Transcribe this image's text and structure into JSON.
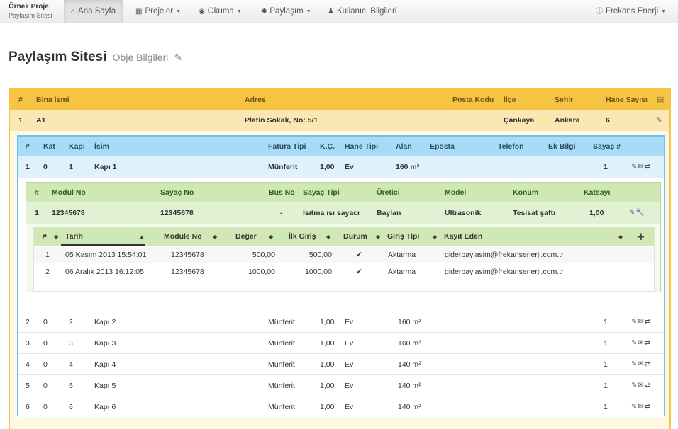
{
  "brand": {
    "name": "Örnek Proje",
    "subtitle": "Paylaşım Sitesi"
  },
  "nav": {
    "items": [
      {
        "label": "Ana Sayfa",
        "icon": "home-icon",
        "glyph": "⌂",
        "active": true
      },
      {
        "label": "Projeler",
        "icon": "briefcase-icon",
        "glyph": "▦",
        "caret": true
      },
      {
        "label": "Okuma",
        "icon": "eye-icon",
        "glyph": "◉",
        "caret": true
      },
      {
        "label": "Paylaşım",
        "icon": "asterisk-icon",
        "glyph": "✱",
        "caret": true
      },
      {
        "label": "Kullanıcı Bilgileri",
        "icon": "user-icon",
        "glyph": "♟"
      }
    ],
    "user": {
      "label": "Frekans Enerji",
      "icon": "info-icon",
      "glyph": "ⓘ"
    }
  },
  "page": {
    "title": "Paylaşım Sitesi",
    "subtitle": "Obje Bilgileri"
  },
  "buildings": {
    "headers": {
      "num": "#",
      "name": "Bina İsmi",
      "address": "Adres",
      "postal": "Posta Kodu",
      "district": "İlçe",
      "city": "Şehir",
      "households": "Hane Sayısı"
    },
    "row": {
      "num": "1",
      "name": "A1",
      "address": "Platin Sokak, No: 5/1",
      "postal": "",
      "district": "Çankaya",
      "city": "Ankara",
      "households": "6"
    }
  },
  "units": {
    "headers": {
      "num": "#",
      "floor": "Kat",
      "door": "Kapı",
      "name": "İsim",
      "invoice": "Fatura Tipi",
      "kc": "K.Ç.",
      "type": "Hane Tipi",
      "area": "Alan",
      "email": "Eposta",
      "phone": "Telefon",
      "extra": "Ek Bilgi",
      "meter": "Sayaç #"
    },
    "rows": [
      {
        "num": "1",
        "floor": "0",
        "door": "1",
        "name": "Kapı 1",
        "invoice": "Münferit",
        "kc": "1,00",
        "type": "Ev",
        "area": "160 m²",
        "meter": "1"
      },
      {
        "num": "2",
        "floor": "0",
        "door": "2",
        "name": "Kapı 2",
        "invoice": "Münferit",
        "kc": "1,00",
        "type": "Ev",
        "area": "160 m²",
        "meter": "1"
      },
      {
        "num": "3",
        "floor": "0",
        "door": "3",
        "name": "Kapı 3",
        "invoice": "Münferit",
        "kc": "1,00",
        "type": "Ev",
        "area": "160 m²",
        "meter": "1"
      },
      {
        "num": "4",
        "floor": "0",
        "door": "4",
        "name": "Kapı 4",
        "invoice": "Münferit",
        "kc": "1,00",
        "type": "Ev",
        "area": "140 m²",
        "meter": "1"
      },
      {
        "num": "5",
        "floor": "0",
        "door": "5",
        "name": "Kapı 5",
        "invoice": "Münferit",
        "kc": "1,00",
        "type": "Ev",
        "area": "140 m²",
        "meter": "1"
      },
      {
        "num": "6",
        "floor": "0",
        "door": "6",
        "name": "Kapı 6",
        "invoice": "Münferit",
        "kc": "1,00",
        "type": "Ev",
        "area": "140 m²",
        "meter": "1"
      }
    ]
  },
  "meters": {
    "headers": {
      "num": "#",
      "module": "Modül No",
      "meter": "Sayaç No",
      "bus": "Bus No",
      "type": "Sayaç Tipi",
      "maker": "Üretici",
      "model": "Model",
      "location": "Konum",
      "factor": "Katsayı"
    },
    "row": {
      "num": "1",
      "module": "12345678",
      "meter": "12345678",
      "bus": "-",
      "type": "Isıtma ısı sayacı",
      "maker": "Baylan",
      "model": "Ultrasonik",
      "location": "Tesisat şaftı",
      "factor": "1,00"
    }
  },
  "readings": {
    "headers": {
      "num": "#",
      "date": "Tarih",
      "module": "Module No",
      "value": "Değer",
      "first": "İlk Giriş",
      "status": "Durum",
      "entry": "Giriş Tipi",
      "by": "Kayıt Eden"
    },
    "rows": [
      {
        "num": "1",
        "date": "05 Kasım 2013 15:54:01",
        "module": "12345678",
        "value": "500,00",
        "first": "500,00",
        "status": "✔",
        "entry": "Aktarma",
        "by": "giderpaylasim@frekansenerji.com.tr"
      },
      {
        "num": "2",
        "date": "06 Aralık 2013 16:12:05",
        "module": "12345678",
        "value": "1000,00",
        "first": "1000,00",
        "status": "✔",
        "entry": "Aktarma",
        "by": "giderpaylasim@frekansenerji.com.tr"
      }
    ]
  },
  "colors": {
    "building": "#f6c343",
    "unit": "#6dc2ee",
    "meter": "#b6d894"
  }
}
